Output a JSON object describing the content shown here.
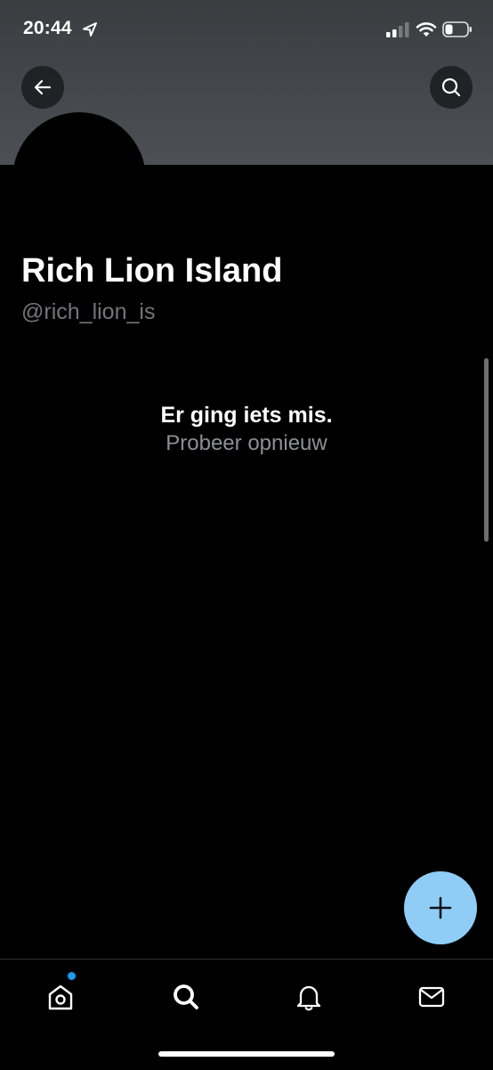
{
  "status_bar": {
    "time": "20:44",
    "icons": [
      "location-arrow-icon",
      "signal-icon",
      "wifi-icon",
      "battery-icon"
    ],
    "battery_level": 0.35
  },
  "header": {
    "back_icon": "arrow-left-icon",
    "search_icon": "search-icon",
    "banner_color": "#45494d"
  },
  "profile": {
    "name": "Rich Lion Island",
    "handle": "@rich_lion_is"
  },
  "error": {
    "title": "Er ging iets mis.",
    "retry": "Probeer opnieuw"
  },
  "fab": {
    "icon": "plus-icon",
    "color": "#8fcdf6"
  },
  "tab_bar": {
    "tabs": [
      {
        "icon": "home-icon",
        "active": false,
        "has_notification_dot": true
      },
      {
        "icon": "search-icon",
        "active": true
      },
      {
        "icon": "bell-icon",
        "active": false
      },
      {
        "icon": "mail-icon",
        "active": false
      }
    ],
    "dot_color": "#1d9bf0"
  },
  "colors": {
    "background": "#000000",
    "secondary_text": "#71767b"
  }
}
